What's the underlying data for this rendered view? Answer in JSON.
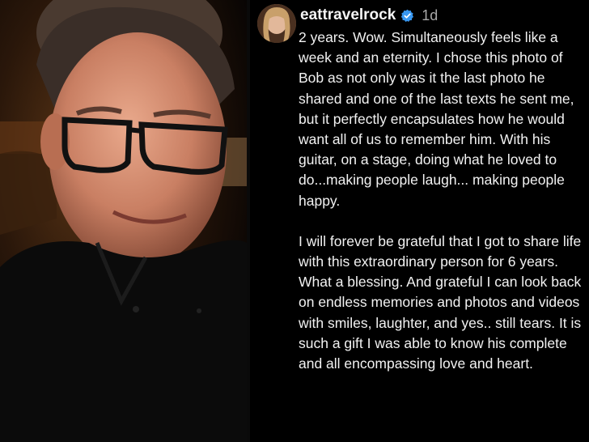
{
  "post": {
    "username": "eattravelrock",
    "timestamp": "1d",
    "caption": [
      "2 years. Wow. Simultaneously feels like a week and an eternity. I chose this photo of Bob as not only was it the last photo he shared and one of the last texts he sent me, but it perfectly encapsulates how he would want all of us to remember him. With his guitar, on a stage, doing what he loved to do...making people laugh... making people happy.",
      "I will forever be grateful that I got to share life with this extraordinary person for 6 years. What a blessing. And grateful I can look back on endless memories and photos and videos with smiles, laughter, and yes.. still tears. It is such a gift I was able to know his complete and all encompassing love and heart."
    ]
  },
  "icons": {
    "verified": "verified-badge-icon",
    "avatar": "profile-avatar"
  },
  "colors": {
    "background": "#000000",
    "text": "#f2f2f2",
    "muted": "#a8a8a8",
    "verified": "#3897f0"
  }
}
